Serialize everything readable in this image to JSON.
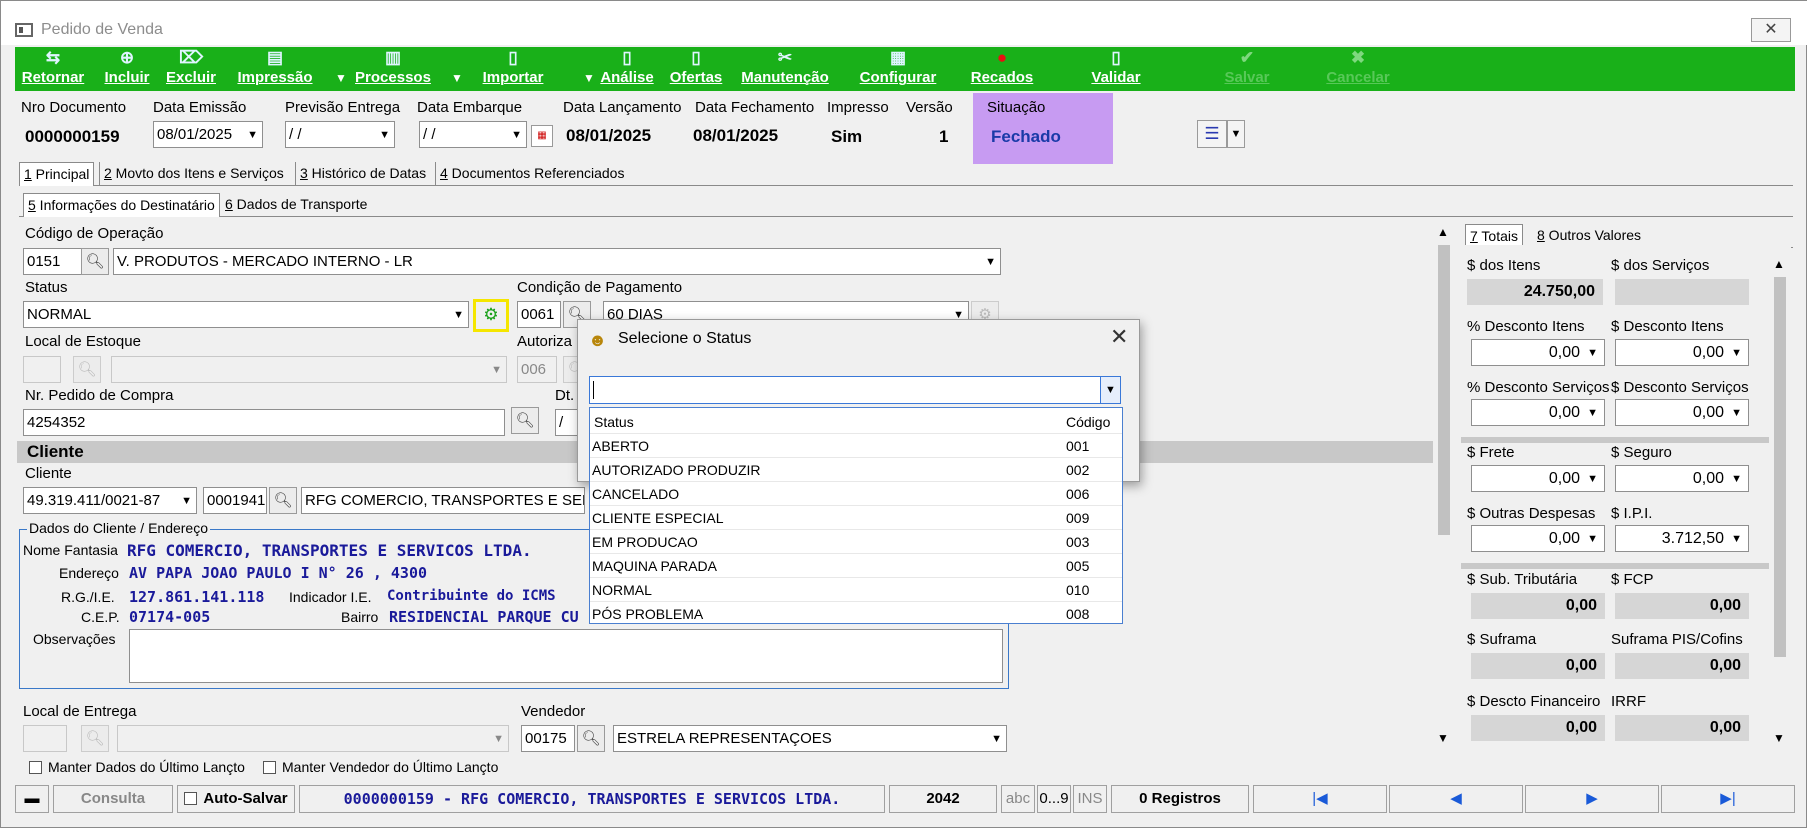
{
  "window": {
    "title": "Pedido de Venda",
    "close_glyph": "✕"
  },
  "toolbar": {
    "items": [
      {
        "label": "Retornar",
        "icon": "back-icon",
        "glyph": "⇆"
      },
      {
        "label": "Incluir",
        "icon": "add-icon",
        "glyph": "⊕"
      },
      {
        "label": "Excluir",
        "icon": "delete-icon",
        "glyph": "⌦"
      },
      {
        "label": "Impressão",
        "icon": "printer-icon",
        "glyph": "▤"
      },
      {
        "label": "Processos",
        "icon": "process-icon",
        "glyph": "▥"
      },
      {
        "label": "Importar",
        "icon": "import-icon",
        "glyph": "▯"
      },
      {
        "label": "Análise",
        "icon": "analysis-icon",
        "glyph": "▯"
      },
      {
        "label": "Ofertas",
        "icon": "offers-icon",
        "glyph": "▯"
      },
      {
        "label": "Manutenção",
        "icon": "tools-icon",
        "glyph": "✂"
      },
      {
        "label": "Configurar",
        "icon": "config-icon",
        "glyph": "▦"
      },
      {
        "label": "Recados",
        "icon": "messages-icon",
        "glyph": "●"
      },
      {
        "label": "Validar",
        "icon": "validate-icon",
        "glyph": "▯"
      },
      {
        "label": "Salvar",
        "icon": "check-icon",
        "glyph": "✔"
      },
      {
        "label": "Cancelar",
        "icon": "cancel-icon",
        "glyph": "✖"
      }
    ]
  },
  "header": {
    "nro_documento_label": "Nro Documento",
    "nro_documento": "0000000159",
    "data_emissao_label": "Data Emissão",
    "data_emissao": "08/01/2025",
    "previsao_entrega_label": "Previsão Entrega",
    "previsao_entrega": " / /",
    "data_embarque_label": "Data Embarque",
    "data_embarque": " / /",
    "data_lancamento_label": "Data Lançamento",
    "data_lancamento": "08/01/2025",
    "data_fechamento_label": "Data Fechamento",
    "data_fechamento": "08/01/2025",
    "impresso_label": "Impresso",
    "impresso": "Sim",
    "versao_label": "Versão",
    "versao": "1",
    "situacao_label": "Situação",
    "situacao": "Fechado",
    "list_glyph": "☰"
  },
  "tabs_main": [
    {
      "key": "1",
      "label": " Principal"
    },
    {
      "key": "2",
      "label": " Movto dos Itens e Serviços"
    },
    {
      "key": "3",
      "label": " Histórico de Datas"
    },
    {
      "key": "4",
      "label": " Documentos Referenciados"
    }
  ],
  "tabs_sub": [
    {
      "key": "5",
      "label": " Informações do Destinatário"
    },
    {
      "key": "6",
      "label": " Dados de Transporte"
    }
  ],
  "form": {
    "codigo_operacao_label": "Código de Operação",
    "codigo_operacao": "0151",
    "operacao_desc": "V. PRODUTOS - MERCADO INTERNO - LR",
    "status_label": "Status",
    "status": "NORMAL",
    "condicao_label": "Condição de Pagamento",
    "condicao_codigo": "0061",
    "condicao_desc": "60 DIAS",
    "local_estoque_label": "Local de Estoque",
    "autoriza_label": "Autoriza",
    "autoriza_codigo": "006",
    "pedido_compra_label": "Nr. Pedido de Compra",
    "pedido_compra": "4254352",
    "dt_label": "Dt.",
    "dt_value": "/",
    "cliente_section": "Cliente",
    "cliente_label": "Cliente",
    "cliente_cnpj": "49.319.411/0021-87",
    "cliente_codigo": "0001941",
    "cliente_nome": "RFG COMERCIO, TRANSPORTES E SERVIC",
    "dados_legend": "Dados do Cliente / Endereço",
    "nome_fantasia_label": "Nome Fantasia",
    "nome_fantasia": "RFG COMERCIO, TRANSPORTES E SERVICOS LTDA.",
    "endereco_label": "Endereço",
    "endereco": "AV PAPA JOAO PAULO I N° 26 , 4300",
    "rgie_label": "R.G./I.E.",
    "rgie": "127.861.141.118",
    "indicador_label": "Indicador I.E.",
    "indicador": "Contribuinte do ICMS",
    "cep_label": "C.E.P.",
    "cep": "07174-005",
    "bairro_label": "Bairro",
    "bairro": "RESIDENCIAL PARQUE CU",
    "observacoes_label": "Observações",
    "local_entrega_label": "Local de Entrega",
    "vendedor_label": "Vendedor",
    "vendedor_codigo": "00175",
    "vendedor_nome": "ESTRELA REPRESENTAÇOES",
    "manter_dados": "Manter Dados do Último Lançto",
    "manter_vendedor": "Manter Vendedor do Último Lançto"
  },
  "totals": {
    "tab7": "7",
    "tab7_label": " Totais",
    "tab8": "8",
    "tab8_label": " Outros Valores",
    "itens_label": "$ dos Itens",
    "itens": "24.750,00",
    "servicos_label": "$ dos Serviços",
    "servicos": "",
    "desc_itens_pct_label": "% Desconto Itens",
    "desc_itens_pct": "0,00",
    "desc_itens_label": "$ Desconto Itens",
    "desc_itens": "0,00",
    "desc_serv_pct_label": "% Desconto Serviços",
    "desc_serv_pct": "0,00",
    "desc_serv_label": "$ Desconto Serviços",
    "desc_serv": "0,00",
    "frete_label": "$ Frete",
    "frete": "0,00",
    "seguro_label": "$ Seguro",
    "seguro": "0,00",
    "outras_label": "$ Outras Despesas",
    "outras": "0,00",
    "ipi_label": "$ I.P.I.",
    "ipi": "3.712,50",
    "subtrib_label": "$ Sub. Tributária",
    "subtrib": "0,00",
    "fcp_label": "$ FCP",
    "fcp": "0,00",
    "suframa_label": "$ Suframa",
    "suframa": "0,00",
    "suframa_pis_label": "Suframa PIS/Cofins",
    "suframa_pis": "0,00",
    "descto_fin_label": "$ Descto Financeiro",
    "descto_fin": "0,00",
    "irrf_label": "IRRF",
    "irrf": "0,00"
  },
  "dialog": {
    "title": "Selecione o Status",
    "col_status": "Status",
    "col_codigo": "Código",
    "rows": [
      {
        "status": "ABERTO",
        "codigo": "001"
      },
      {
        "status": "AUTORIZADO PRODUZIR",
        "codigo": "002"
      },
      {
        "status": "CANCELADO",
        "codigo": "006"
      },
      {
        "status": "CLIENTE ESPECIAL",
        "codigo": "009"
      },
      {
        "status": "EM PRODUCAO",
        "codigo": "003"
      },
      {
        "status": "MAQUINA PARADA",
        "codigo": "005"
      },
      {
        "status": "NORMAL",
        "codigo": "010"
      },
      {
        "status": "PÓS PROBLEMA",
        "codigo": "008"
      }
    ]
  },
  "statusbar": {
    "mode": "Consulta",
    "autosave": "Auto-Salvar",
    "record": "0000000159 - RFG COMERCIO, TRANSPORTES E SERVICOS LTDA.",
    "number": "2042",
    "abc": "abc",
    "digits": "0...9",
    "ins": "INS",
    "registros": "0 Registros",
    "first": "|◀",
    "prev": "◀",
    "next": "▶",
    "last": "▶|"
  },
  "colors": {
    "toolbar_green": "#19b019",
    "situacao_highlight": "#c79bf2",
    "status_highlight": "#f5e600",
    "value_blue": "#1a1a9a"
  }
}
